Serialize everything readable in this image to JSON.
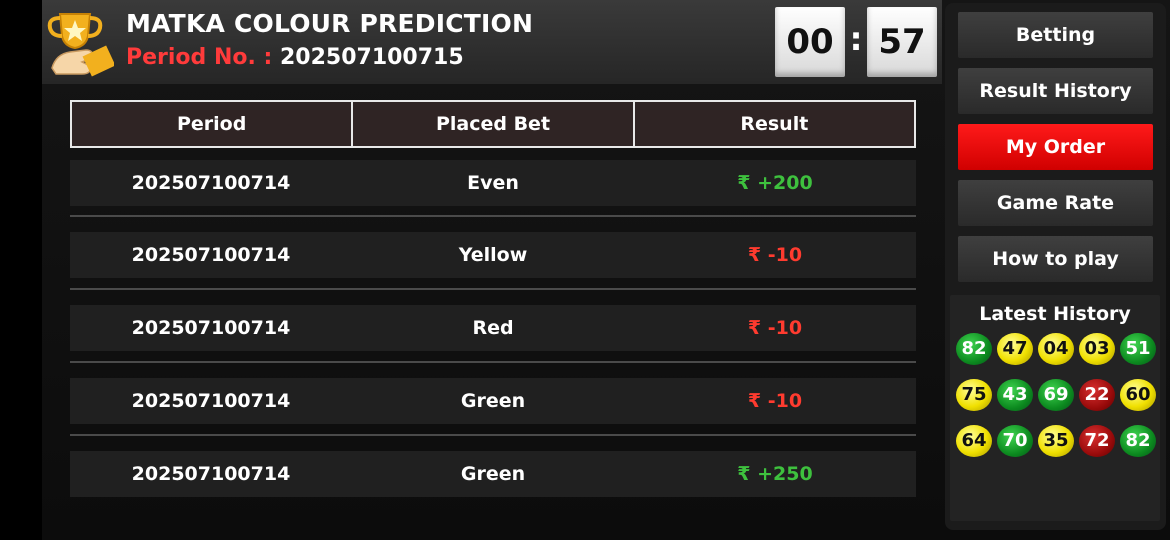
{
  "header": {
    "title": "MATKA COLOUR PREDICTION",
    "period_label": "Period No. : ",
    "period_value": "202507100715",
    "timer_minutes": "00",
    "timer_separator": ":",
    "timer_seconds": "57",
    "trophy_icon": "trophy-icon"
  },
  "table": {
    "columns": [
      "Period",
      "Placed Bet",
      "Result"
    ],
    "rows": [
      {
        "period": "202507100714",
        "bet": "Even",
        "result": "₹ +200",
        "status": "win"
      },
      {
        "period": "202507100714",
        "bet": "Yellow",
        "result": "₹ -10",
        "status": "loss"
      },
      {
        "period": "202507100714",
        "bet": "Red",
        "result": "₹ -10",
        "status": "loss"
      },
      {
        "period": "202507100714",
        "bet": "Green",
        "result": "₹ -10",
        "status": "loss"
      },
      {
        "period": "202507100714",
        "bet": "Green",
        "result": "₹ +250",
        "status": "win"
      }
    ]
  },
  "sidebar": {
    "items": [
      {
        "label": "Betting",
        "active": false
      },
      {
        "label": "Result History",
        "active": false
      },
      {
        "label": "My Order",
        "active": true
      },
      {
        "label": "Game Rate",
        "active": false
      },
      {
        "label": "How to play",
        "active": false
      }
    ],
    "history_title": "Latest History",
    "history": [
      {
        "num": "82",
        "color": "green"
      },
      {
        "num": "47",
        "color": "yellow"
      },
      {
        "num": "04",
        "color": "yellow"
      },
      {
        "num": "03",
        "color": "yellow"
      },
      {
        "num": "51",
        "color": "green"
      },
      {
        "num": "75",
        "color": "yellow"
      },
      {
        "num": "43",
        "color": "green"
      },
      {
        "num": "69",
        "color": "green"
      },
      {
        "num": "22",
        "color": "red"
      },
      {
        "num": "60",
        "color": "yellow"
      },
      {
        "num": "64",
        "color": "yellow"
      },
      {
        "num": "70",
        "color": "green"
      },
      {
        "num": "35",
        "color": "yellow"
      },
      {
        "num": "72",
        "color": "red"
      },
      {
        "num": "82",
        "color": "green"
      }
    ]
  },
  "colors": {
    "accent_red": "#ff1a1a",
    "win_green": "#3ec13e",
    "loss_red": "#ff3b2f"
  }
}
